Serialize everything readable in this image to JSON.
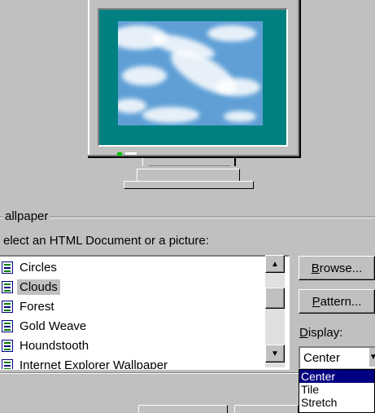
{
  "wallpaper_group": {
    "label": "allpaper",
    "prompt": "elect an HTML Document or a picture:"
  },
  "list": {
    "items": [
      {
        "label": "Circles",
        "selected": false
      },
      {
        "label": "Clouds",
        "selected": true
      },
      {
        "label": "Forest",
        "selected": false
      },
      {
        "label": "Gold Weave",
        "selected": false
      },
      {
        "label": "Houndstooth",
        "selected": false
      },
      {
        "label": "Internet Explorer Wallpaper",
        "selected": false
      }
    ]
  },
  "buttons": {
    "browse": {
      "prefix": "",
      "accel": "B",
      "rest": "rowse..."
    },
    "pattern": {
      "prefix": "",
      "accel": "P",
      "rest": "attern..."
    }
  },
  "display": {
    "label_accel": "D",
    "label_rest": "isplay:",
    "value": "Center",
    "options": [
      "Center",
      "Tile",
      "Stretch"
    ],
    "selected_option": "Center"
  },
  "icons": {
    "list_item": "html-document-icon",
    "scroll_up": "up-arrow-icon",
    "scroll_down": "down-arrow-icon",
    "combo": "chevron-down-icon"
  },
  "colors": {
    "face": "#c0c0c0",
    "monitor_bezel": "#008080",
    "selection": "#000080"
  }
}
